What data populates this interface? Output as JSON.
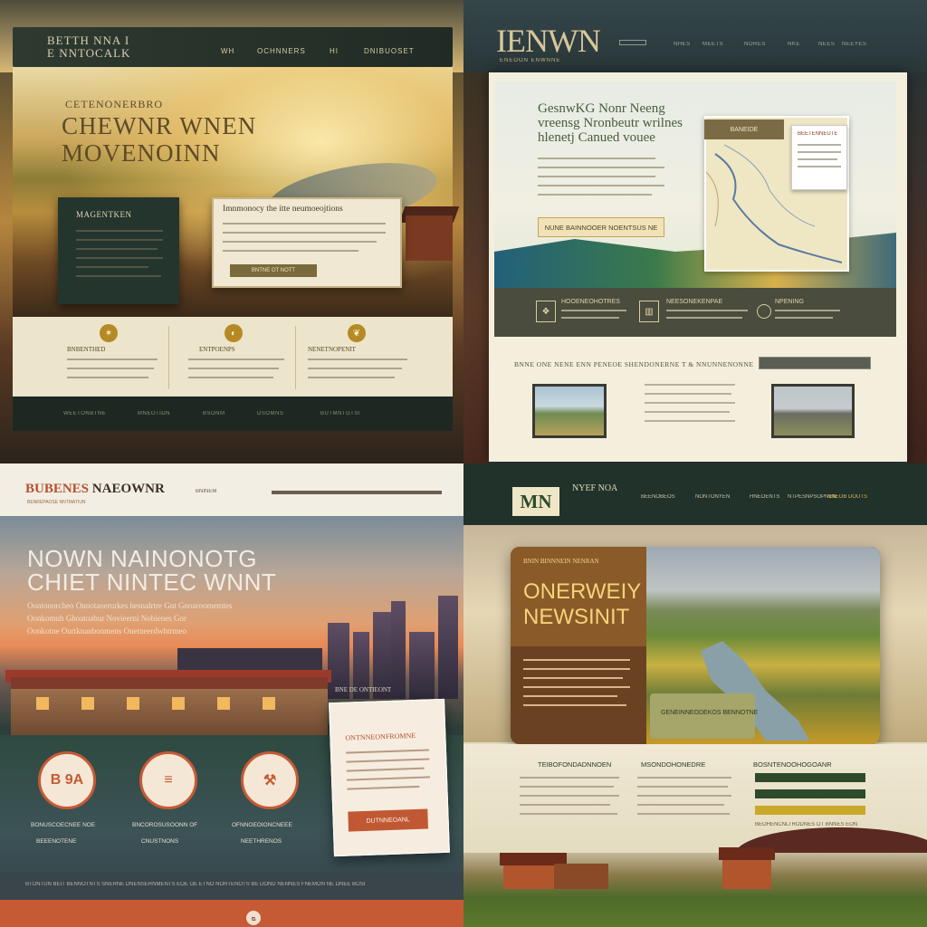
{
  "q1": {
    "logo_line1": "BETTH NNA I",
    "logo_line2": "E NNTOCALK",
    "nav": [
      "WH",
      "OCHNNERS",
      "HI",
      "DNIBUOSET"
    ],
    "hero_kicker": "CETENONERBRO",
    "hero_title_1": "CHEWNR WNEN",
    "hero_title_2": "MOVENOINN",
    "dark_card_title": "MAGENTKEN",
    "light_card_title": "Imnmonocy the itte neumoeojtions",
    "light_card_button": "BNTNE OT NOTT",
    "features": [
      "BNBENTHED",
      "ENTPOENPS",
      "NENETNOPENIT"
    ],
    "footer": [
      "WEETONBTNE",
      "MNEOTIDN",
      "BSONM",
      "DSOMNS",
      "BUTMNTGTSI"
    ]
  },
  "q2": {
    "logo": "IENWN",
    "logo_sub": "ENEOON ENWNNE",
    "nav": [
      "NHES",
      "MEETS",
      "NORES",
      "NKE",
      "NEES",
      "NEEYES"
    ],
    "hero_title_1": "GesnwKG Nonr Neeng",
    "hero_title_2": "vreensg Nronbeutr wrilnes",
    "hero_title_3": "hlenetj Canued vouee",
    "hero_cta": "NUNE BAINNOOER NOENTSUS NE",
    "map_label": "BANEIDE",
    "map_note": "BEETENNEUTE",
    "band": [
      {
        "icon": "❖",
        "text": "HOOENEOHOTRES"
      },
      {
        "icon": "▥",
        "text": "NEESONEKENPAE"
      },
      {
        "icon": "",
        "text": "NPENING"
      }
    ],
    "section_title": "BNNE ONE NENE ENN PENEOE SHENDONERNE T & NNUNNENONNE"
  },
  "q3": {
    "brand_a": "BUBENES",
    "brand_b": "NAEOWNR",
    "brand_sub": "BENREPAOSE NNTMATIUN",
    "nav": "BNINEM",
    "title_1": "NOWN NAINONOTG",
    "title_2": "CHIET NINTEC WNNT",
    "sub_1": "Oontonorcheo Onnotaoerurkes hesnalrtre Gnt Gnoaroomemtes",
    "sub_2": "Oonkomuh Ghoatoabur Novieerni Nobienes Gor",
    "sub_3": "Oonkotne Ourtknanbonmens Onetneerdwhtrmeo",
    "hero_caption": "BNE DE ONTIEONT",
    "popup_title": "ONTNNEONFROMNE",
    "popup_button": "DUTNNEOANL",
    "badges": [
      {
        "icon": "B 9A",
        "cap1": "BONUSCOECNEE NOE",
        "cap2": "BEEENOTENE"
      },
      {
        "icon": "≡",
        "cap1": "BNCOROSUSOONN OF",
        "cap2": "CNUSTNONS"
      },
      {
        "icon": "⚒",
        "cap1": "OFNNOEOIONCNEEE",
        "cap2": "NEETHRENOS"
      }
    ],
    "footer_text": "BTONTUN BEIT BENNOTNTS SNERNE DNENSERNMENTS EOE OE ETNO NORTENOTS BE DOND NENNES FNEMON NE DNEE BOSI",
    "footer_icon": "ᴓ"
  },
  "q4": {
    "logo": "MN",
    "logo_title": "NYEF NOA",
    "nav": [
      "BEENOBEOS",
      "NONTONYEN",
      "HNEOENTS",
      "NTPESNPSOPNEN"
    ],
    "nav_active": "NNEOB DOUTS",
    "hero_kicker": "BNIN BINNNEIN NENRAN",
    "hero_title_1": "ONERWEIY",
    "hero_title_2": "NEWSINIT",
    "image_card": "GENEINNEODEKOS BENNOTNE",
    "columns": [
      "TEIBOFONDADNNOEN",
      "MSONDOHONEDRE",
      "BOSNTENOOHOGOANR"
    ],
    "bottom_text": "BEOHENCNLTRODNES OT BNNES EON"
  }
}
